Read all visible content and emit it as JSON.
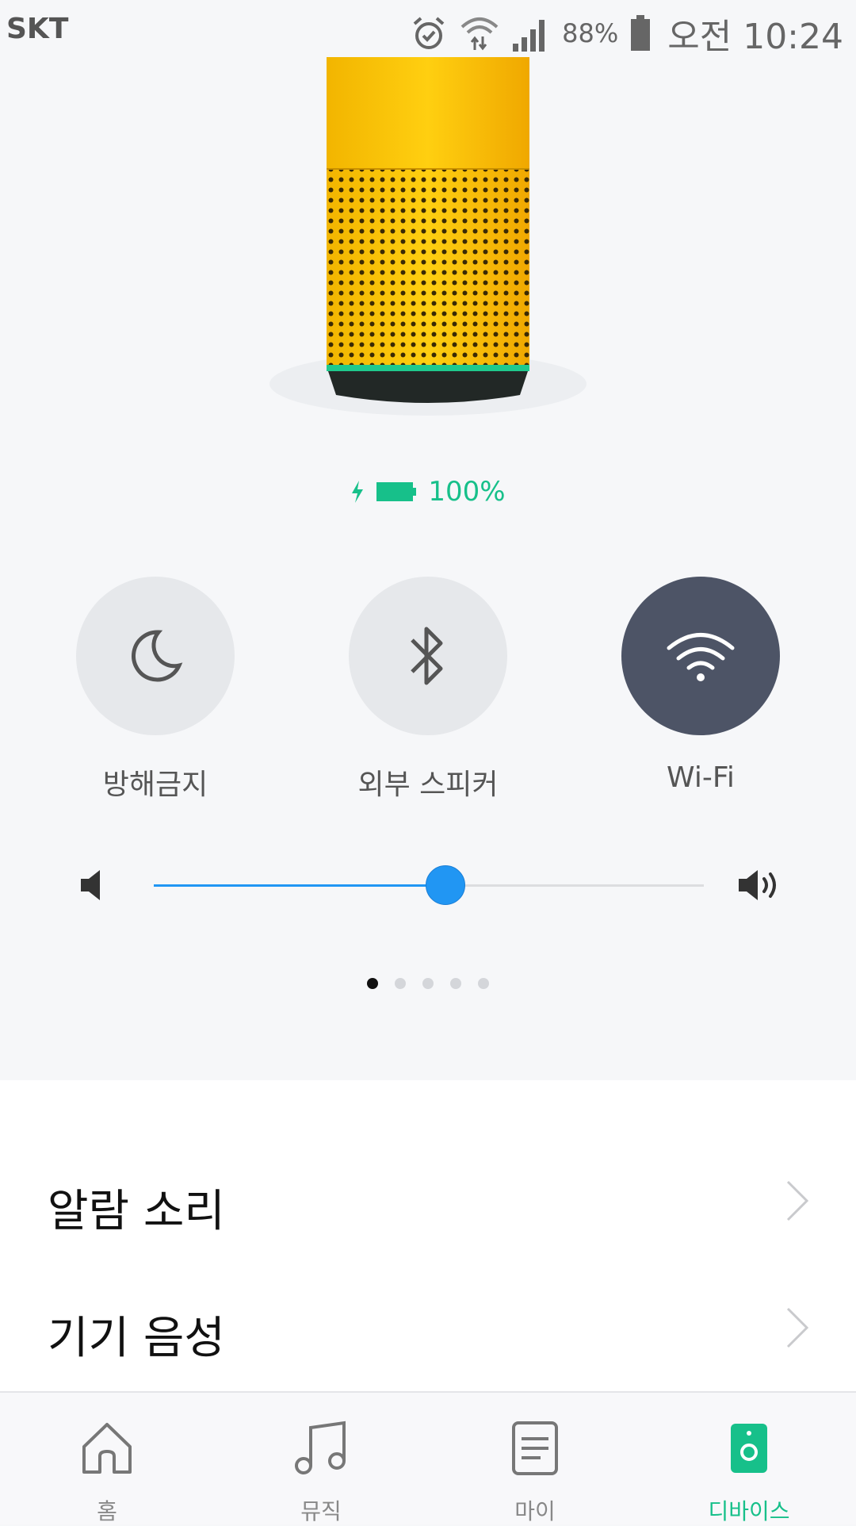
{
  "status_bar": {
    "carrier": "SKT",
    "battery_percent": "88%",
    "time": "오전 10:24",
    "icons": [
      "alarm-icon",
      "wifi-data-icon",
      "signal-icon",
      "battery-icon"
    ]
  },
  "device": {
    "image": "yellow-speaker",
    "battery_level": "100%",
    "charging": true
  },
  "toggles": [
    {
      "label": "방해금지",
      "icon": "moon-icon",
      "active": false
    },
    {
      "label": "외부 스피커",
      "icon": "bluetooth-icon",
      "active": false
    },
    {
      "label": "Wi-Fi",
      "icon": "wifi-icon",
      "active": true
    }
  ],
  "volume": {
    "level_fraction": 0.53
  },
  "pager": {
    "count": 5,
    "active_index": 0
  },
  "settings": [
    {
      "label": "알람 소리"
    },
    {
      "label": "기기 음성"
    }
  ],
  "bottom_nav": [
    {
      "label": "홈",
      "icon": "home-icon",
      "active": false
    },
    {
      "label": "뮤직",
      "icon": "music-icon",
      "active": false
    },
    {
      "label": "마이",
      "icon": "document-icon",
      "active": false
    },
    {
      "label": "디바이스",
      "icon": "speaker-icon",
      "active": true
    }
  ],
  "colors": {
    "accent_green": "#17c08a",
    "slider_blue": "#2196f3",
    "toggle_active": "#4d5466",
    "toggle_inactive": "#e6e8eb",
    "speaker_yellow": "#f8bd0a"
  }
}
